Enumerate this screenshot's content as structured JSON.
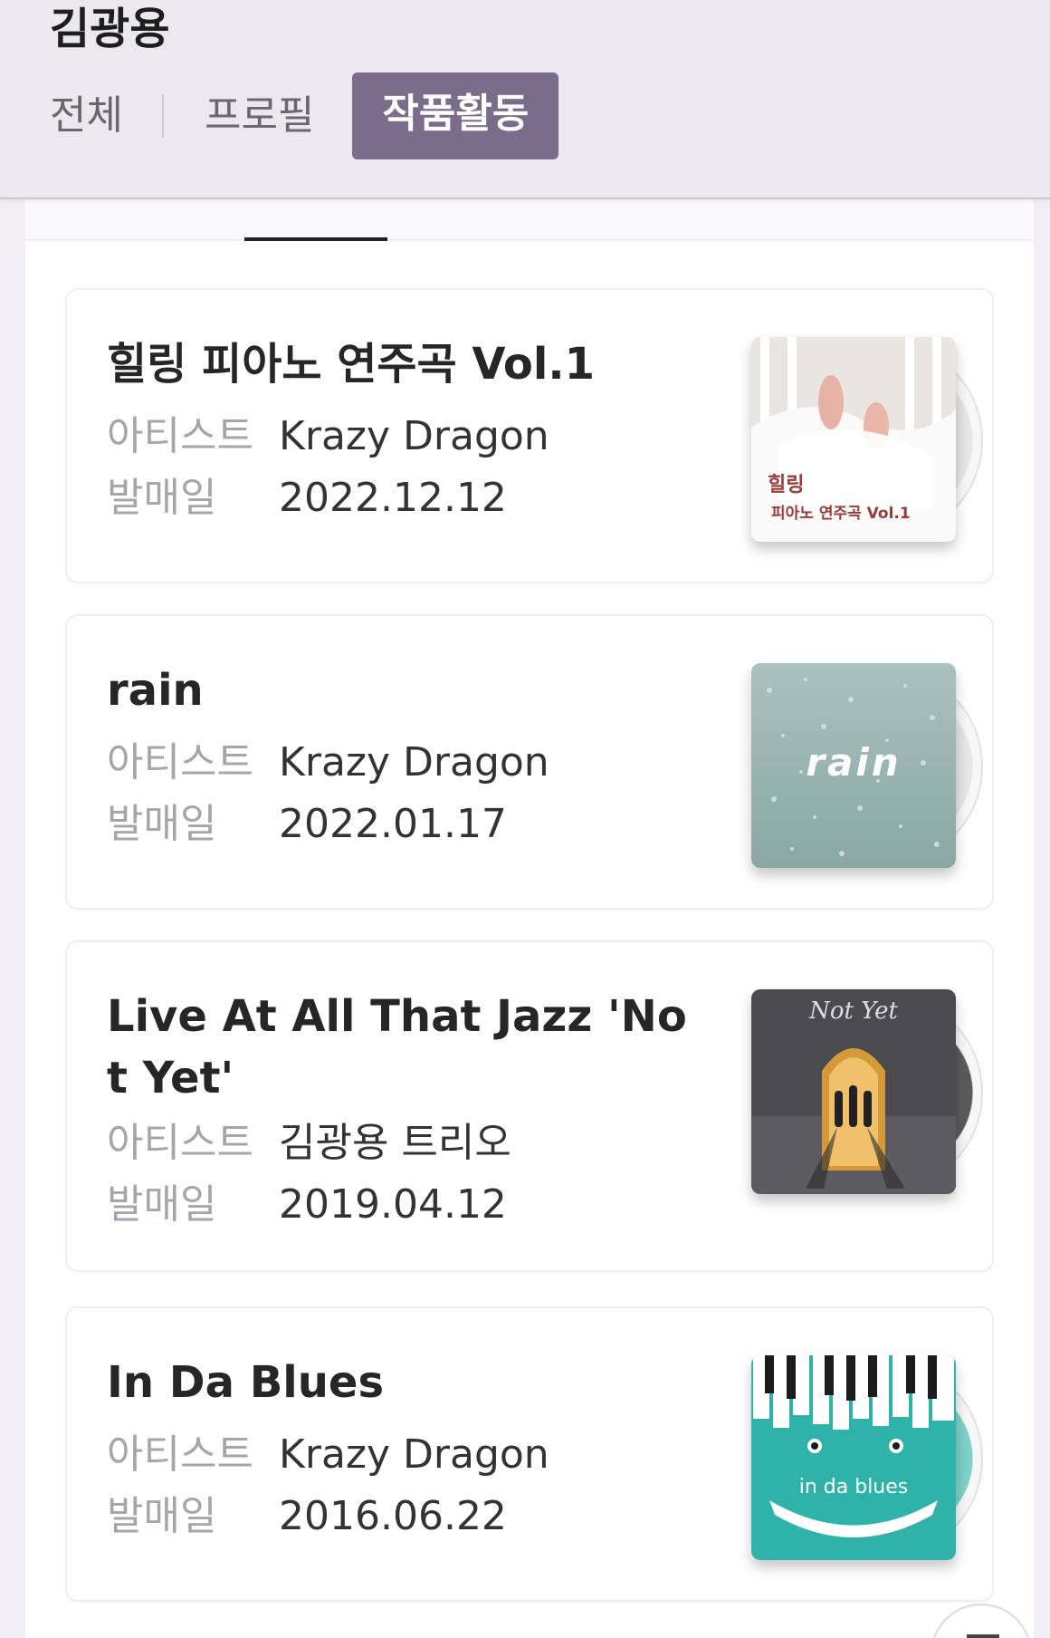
{
  "header": {
    "artist_name": "김광용",
    "tabs": {
      "all": "전체",
      "profile": "프로필",
      "works": "작품활동"
    }
  },
  "labels": {
    "artist": "아티스트",
    "release": "발매일"
  },
  "albums": [
    {
      "title": "힐링 피아노 연주곡 Vol.1",
      "artist": "Krazy Dragon",
      "release_date": "2022.12.12",
      "cover_text": [
        "힐링",
        "피아노 연주곡 Vol.1"
      ]
    },
    {
      "title": "rain",
      "artist": "Krazy Dragon",
      "release_date": "2022.01.17",
      "cover_text": [
        "rain"
      ]
    },
    {
      "title": "Live At All That Jazz 'Not Yet'",
      "artist": "김광용 트리오",
      "release_date": "2019.04.12",
      "cover_text": [
        "Not Yet"
      ]
    },
    {
      "title": "In Da Blues",
      "artist": "Krazy Dragon",
      "release_date": "2016.06.22",
      "cover_text": [
        "in da blues"
      ]
    }
  ]
}
